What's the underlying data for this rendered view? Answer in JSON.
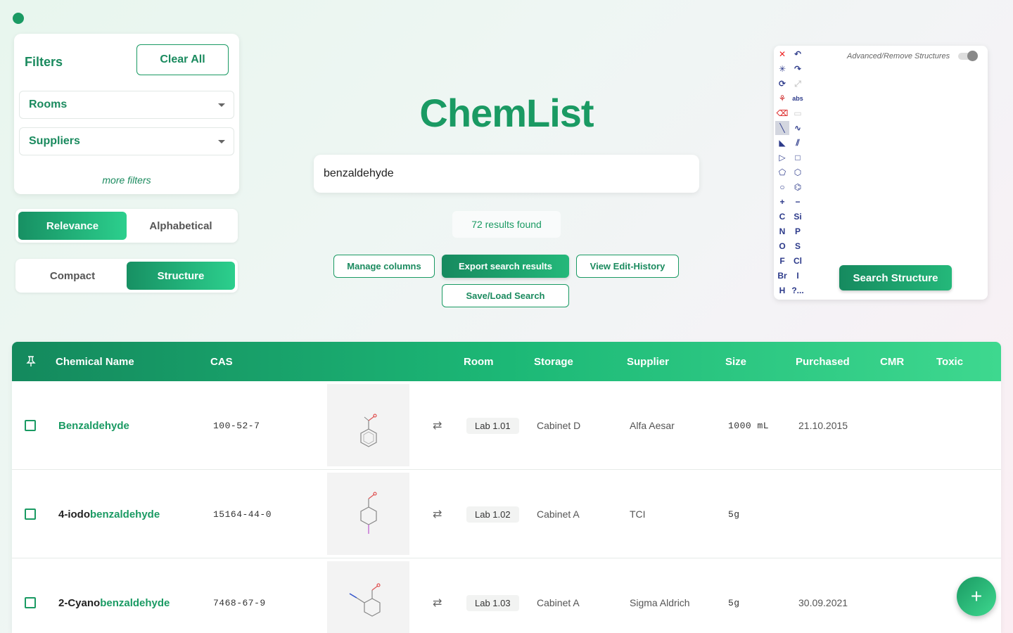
{
  "app": {
    "title": "ChemList"
  },
  "filters": {
    "title": "Filters",
    "clear_all": "Clear All",
    "rooms": "Rooms",
    "suppliers": "Suppliers",
    "more_filters": "more filters"
  },
  "sort": {
    "relevance": "Relevance",
    "alphabetical": "Alphabetical",
    "active": "relevance"
  },
  "view": {
    "compact": "Compact",
    "structure": "Structure",
    "active": "structure"
  },
  "search": {
    "value": "benzaldehyde",
    "results": "72 results found"
  },
  "actions": {
    "manage_columns": "Manage columns",
    "export": "Export search results",
    "history": "View Edit-History",
    "save_load": "Save/Load Search"
  },
  "editor": {
    "advanced_label": "Advanced/Remove Structures",
    "search_button": "Search Structure",
    "elements": [
      "C",
      "Si",
      "N",
      "P",
      "O",
      "S",
      "F",
      "Cl",
      "Br",
      "I",
      "H",
      "?..."
    ],
    "abs_label": "abs"
  },
  "table": {
    "columns": {
      "pin": "⌘",
      "name": "Chemical Name",
      "cas": "CAS",
      "room": "Room",
      "storage": "Storage",
      "supplier": "Supplier",
      "size": "Size",
      "purchased": "Purchased",
      "cmr": "CMR",
      "toxic": "Toxic"
    },
    "rows": [
      {
        "name_plain": "",
        "name_hl": "Benzaldehyde",
        "cas": "100-52-7",
        "room": "Lab 1.01",
        "storage": "Cabinet D",
        "supplier": "Alfa Aesar",
        "size": "1000 mL",
        "purchased": "21.10.2015"
      },
      {
        "name_plain": "4-iodo",
        "name_hl": "benzaldehyde",
        "cas": "15164-44-0",
        "room": "Lab 1.02",
        "storage": "Cabinet A",
        "supplier": "TCI",
        "size": "5g",
        "purchased": ""
      },
      {
        "name_plain": "2-Cyano",
        "name_hl": "benzaldehyde",
        "cas": "7468-67-9",
        "room": "Lab 1.03",
        "storage": "Cabinet A",
        "supplier": "Sigma Aldrich",
        "size": "5g",
        "purchased": "30.09.2021"
      }
    ]
  },
  "fab": {
    "label": "+"
  },
  "colors": {
    "accent": "#1a9a63",
    "accent_light": "#3ed88f"
  }
}
